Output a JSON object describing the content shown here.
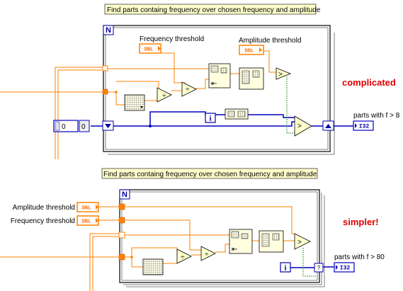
{
  "top": {
    "comment": "Find parts containg frequency over chosen frequency and amplitude",
    "freq_label": "Frequency threshold",
    "amp_label": "Amplitude threshold",
    "dbl1": "DBL",
    "dbl2": "DBL",
    "loop_count": "N",
    "iter_icon": "i",
    "numeric_value": "0",
    "numeric_index": "0",
    "indicator_label": "parts with f > 8",
    "indicator_type": "I32",
    "note": "complicated"
  },
  "bottom": {
    "comment": "Find parts containg frequency over chosen frequency and amplitude",
    "amp_label": "Amplitude threshold",
    "freq_label": "Frequency threshold",
    "dbl1": "DBL",
    "dbl2": "DBL",
    "loop_count": "N",
    "iter_icon": "i",
    "indicator_label": "parts with f > 80",
    "indicator_type": "I32",
    "note": "simpler!"
  },
  "colors": {
    "orange_wire": "#ff8000",
    "blue_wire": "#0000c0",
    "loop_border": "#000000",
    "note": "#dd0000"
  }
}
